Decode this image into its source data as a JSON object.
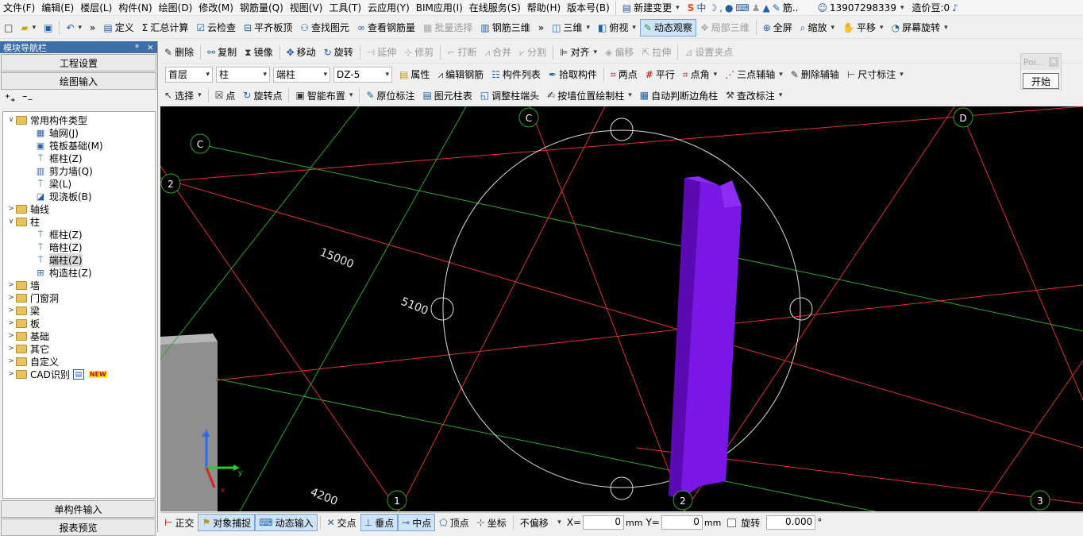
{
  "menu": [
    "文件(F)",
    "编辑(E)",
    "楼层(L)",
    "构件(N)",
    "绘图(D)",
    "修改(M)",
    "钢筋量(Q)",
    "视图(V)",
    "工具(T)",
    "云应用(Y)",
    "BIM应用(I)",
    "在线服务(S)",
    "帮助(H)",
    "版本号(B)"
  ],
  "menu_extra": {
    "new_change": "新建变更",
    "partial": "筋..",
    "phone": "13907298339",
    "price": "造价豆:0"
  },
  "toolbar1": {
    "define": "定义",
    "sum": "汇总计算",
    "cloud_check": "云检查",
    "flat_top": "平齐板顶",
    "find": "查找图元",
    "view_rebar": "查看钢筋量",
    "batch_select": "批量选择",
    "rebar_3d": "钢筋三维",
    "three_d": "三维",
    "top_view": "俯视",
    "dynamic": "动态观察",
    "local_3d": "局部三维",
    "fullscreen": "全屏",
    "zoom": "缩放",
    "pan": "平移",
    "rotate": "屏幕旋转"
  },
  "toolbar2": {
    "delete": "删除",
    "copy": "复制",
    "mirror": "镜像",
    "move": "移动",
    "rotate": "旋转",
    "extend": "延伸",
    "trim": "修剪",
    "break": "打断",
    "merge": "合并",
    "split": "分割",
    "align": "对齐",
    "offset": "偏移",
    "stretch": "拉伸",
    "set_clamp": "设置夹点"
  },
  "toolbar3": {
    "floor": "首层",
    "type": "柱",
    "subtype": "端柱",
    "name": "DZ-5",
    "property": "属性",
    "edit_rebar": "编辑钢筋",
    "component_list": "构件列表",
    "pick": "拾取构件",
    "two_point": "两点",
    "parallel": "平行",
    "corner": "点角",
    "three_point_aux": "三点辅轴",
    "delete_aux": "删除辅轴",
    "dimension": "尺寸标注"
  },
  "toolbar4": {
    "select": "选择",
    "point": "点",
    "rotate_point": "旋转点",
    "smart_layout": "智能布置",
    "in_place": "原位标注",
    "col_table": "图元柱表",
    "adjust_end": "调整柱端头",
    "by_wall": "按墙位置绘制柱",
    "auto_corner": "自动判断边角柱",
    "change_label": "查改标注"
  },
  "panel": {
    "title": "模块导航栏",
    "pin": "ᵠ",
    "close": "×",
    "settings": "工程设置",
    "draw_input": "绘图输入",
    "single_input": "单构件输入",
    "report": "报表预览",
    "tree": [
      {
        "label": "常用构件类型",
        "level": 0,
        "expand": "∨",
        "icon": "folder"
      },
      {
        "label": "轴网(J)",
        "level": 1,
        "icon": "grid"
      },
      {
        "label": "筏板基础(M)",
        "level": 1,
        "icon": "raft"
      },
      {
        "label": "框柱(Z)",
        "level": 1,
        "icon": "col"
      },
      {
        "label": "剪力墙(Q)",
        "level": 1,
        "icon": "wall"
      },
      {
        "label": "梁(L)",
        "level": 1,
        "icon": "beam"
      },
      {
        "label": "现浇板(B)",
        "level": 1,
        "icon": "slab"
      },
      {
        "label": "轴线",
        "level": 0,
        "expand": ">",
        "icon": "folder"
      },
      {
        "label": "柱",
        "level": 0,
        "expand": "∨",
        "icon": "folder"
      },
      {
        "label": "框柱(Z)",
        "level": 1,
        "icon": "col"
      },
      {
        "label": "暗柱(Z)",
        "level": 1,
        "icon": "col"
      },
      {
        "label": "端柱(Z)",
        "level": 1,
        "icon": "col",
        "selected": true
      },
      {
        "label": "构造柱(Z)",
        "level": 1,
        "icon": "cons"
      },
      {
        "label": "墙",
        "level": 0,
        "expand": ">",
        "icon": "folder"
      },
      {
        "label": "门窗洞",
        "level": 0,
        "expand": ">",
        "icon": "folder"
      },
      {
        "label": "梁",
        "level": 0,
        "expand": ">",
        "icon": "folder"
      },
      {
        "label": "板",
        "level": 0,
        "expand": ">",
        "icon": "folder"
      },
      {
        "label": "基础",
        "level": 0,
        "expand": ">",
        "icon": "folder"
      },
      {
        "label": "其它",
        "level": 0,
        "expand": ">",
        "icon": "folder"
      },
      {
        "label": "自定义",
        "level": 0,
        "expand": ">",
        "icon": "folder"
      },
      {
        "label": "CAD识别",
        "level": 0,
        "expand": ">",
        "icon": "folder",
        "new": "NEW"
      }
    ]
  },
  "canvas": {
    "grid_labels": [
      "C",
      "C",
      "D",
      "2",
      "1",
      "2",
      "3"
    ],
    "dimensions": [
      "15000",
      "5100",
      "4200"
    ]
  },
  "poi": {
    "title": "Poi...",
    "start": "开始"
  },
  "status": {
    "ortho": "正交",
    "snap": "对象捕捉",
    "dynamic_input": "动态输入",
    "intersection": "交点",
    "perpendicular": "垂点",
    "midpoint": "中点",
    "vertex": "顶点",
    "coordinate": "坐标",
    "offset_mode": "不偏移",
    "x_label": "X=",
    "x_value": "0",
    "y_label": "Y=",
    "y_value": "0",
    "unit": "mm",
    "rotate_label": "旋转",
    "rotate_value": "0.000",
    "degree": "°"
  }
}
